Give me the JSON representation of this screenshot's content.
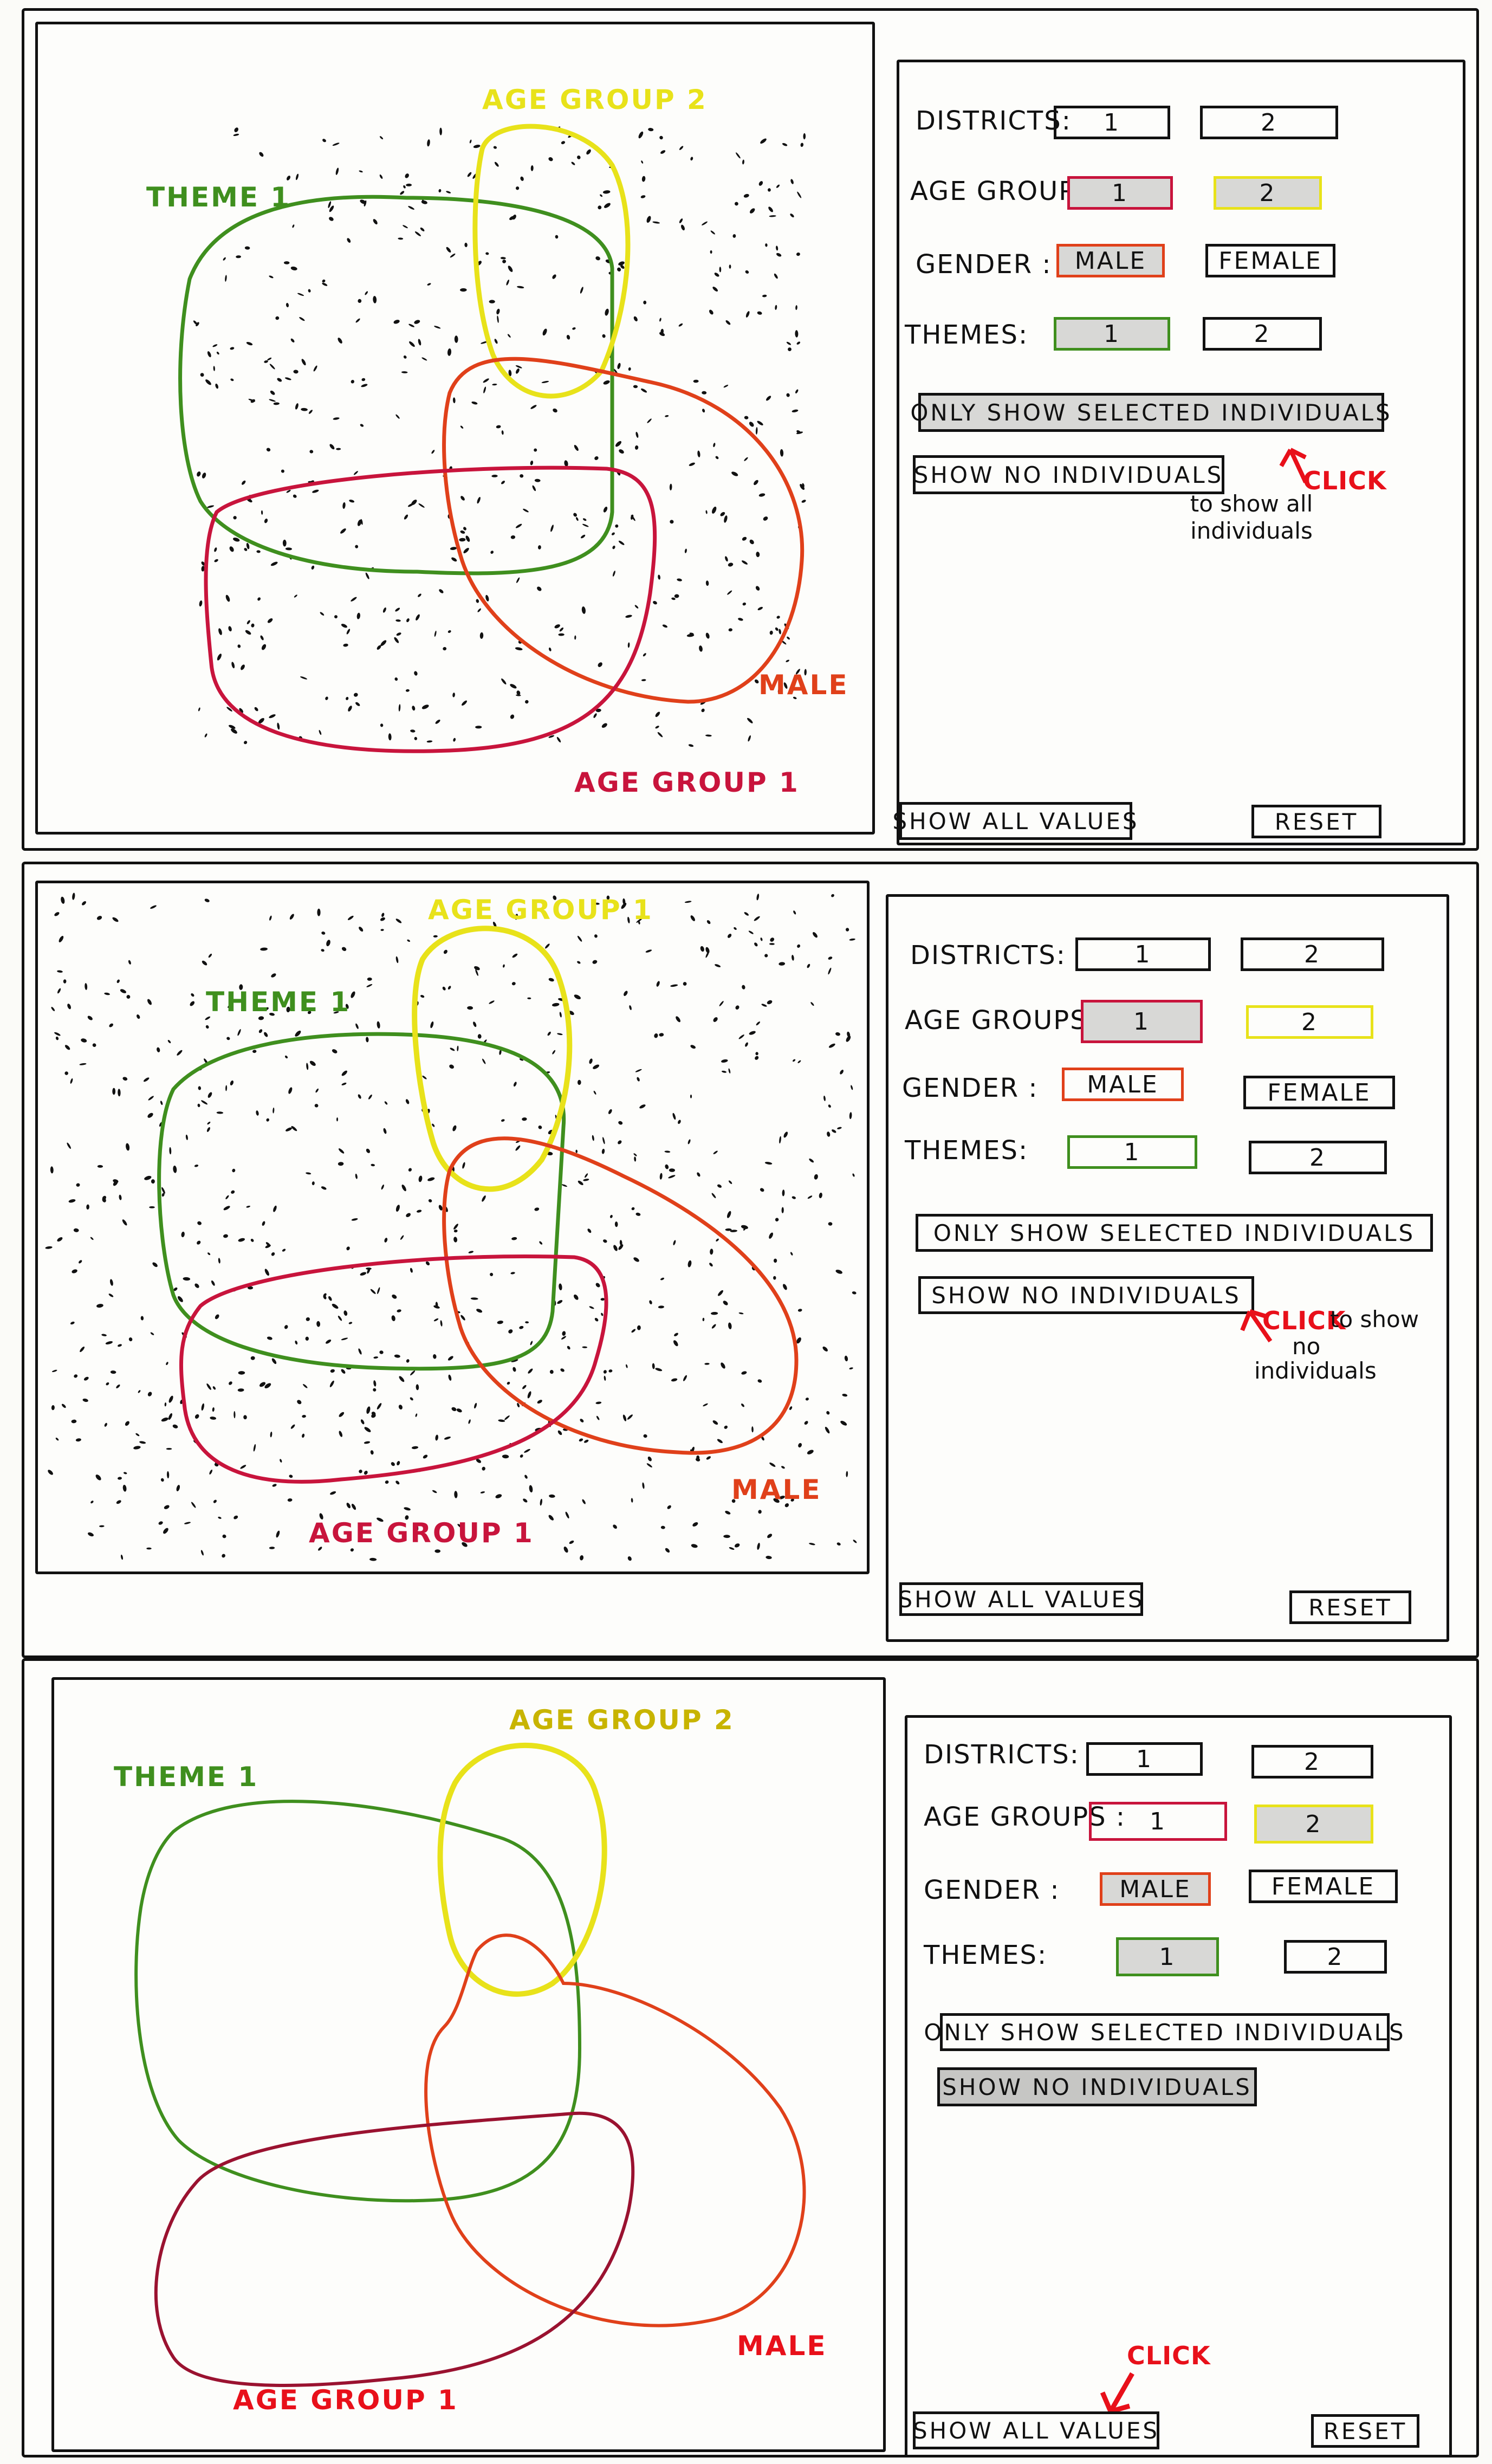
{
  "colors": {
    "theme": "#3f8f1e",
    "age_group_2": "#e8e21a",
    "male": "#e0401a",
    "age_group_1": "#c8143c",
    "click": "#e8101a",
    "ink": "#111111"
  },
  "panels": {
    "districts_label": "DISTRICTS:",
    "age_groups_label": "AGE GROUPS :",
    "gender_label": "GENDER :",
    "themes_label": "THEMES:",
    "district_1": "1",
    "district_2": "2",
    "age_group_1": "1",
    "age_group_2": "2",
    "male": "MALE",
    "female": "FEMALE",
    "theme_1": "1",
    "theme_2": "2",
    "only_selected": "ONLY SHOW SELECTED INDIVIDUALS",
    "show_no_individuals": "SHOW NO INDIVIDUALS",
    "show_all_values": "SHOW ALL VALUES",
    "reset": "RESET"
  },
  "sketch1": {
    "theme_label": "THEME 1",
    "age_top_label": "AGE GROUP 2",
    "male_label": "MALE",
    "age_bottom_label": "AGE GROUP 1",
    "click": "CLICK",
    "note_line1": "to show all",
    "note_line2": "individuals"
  },
  "sketch2": {
    "theme_label": "THEME 1",
    "age_top_label": "AGE GROUP 1",
    "male_label": "MALE",
    "age_bottom_label": "AGE GROUP 1",
    "click": "CLICK",
    "note_line1": "to show",
    "note_line2": "no",
    "note_line3": "individuals"
  },
  "sketch3": {
    "theme_label": "THEME 1",
    "age_top_label": "AGE GROUP 2",
    "male_label": "MALE",
    "age_bottom_label": "AGE GROUP 1",
    "click": "CLICK"
  }
}
